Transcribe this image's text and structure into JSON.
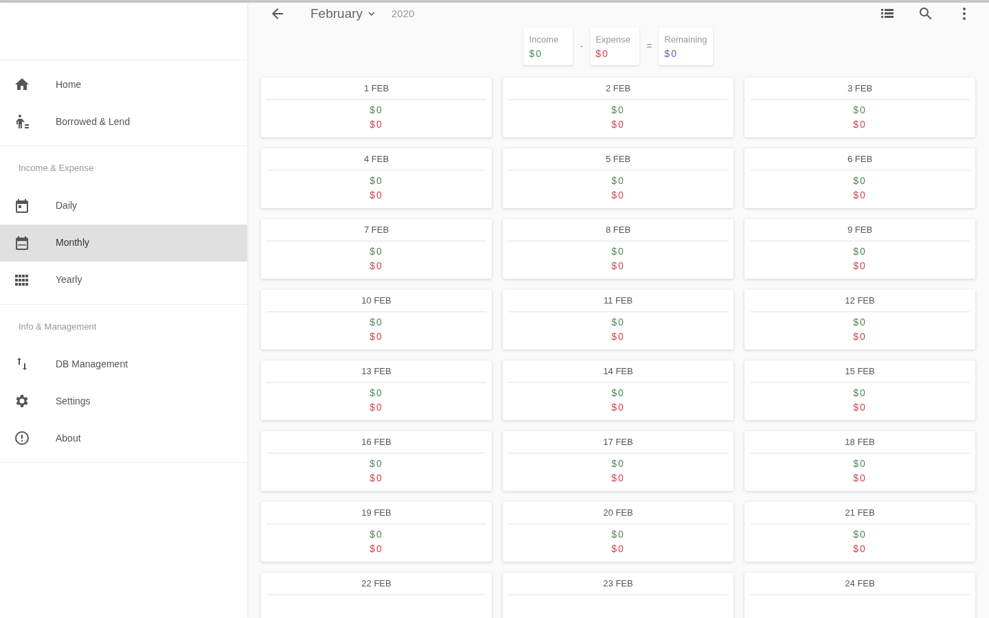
{
  "sidebar": {
    "groups": [
      {
        "items": [
          {
            "label": "Home",
            "kind": "home",
            "selected": false
          },
          {
            "label": "Borrowed & Lend",
            "kind": "person",
            "selected": false
          }
        ]
      },
      {
        "heading": "Income & Expense",
        "items": [
          {
            "label": "Daily",
            "kind": "daily",
            "selected": false
          },
          {
            "label": "Monthly",
            "kind": "monthly",
            "selected": true
          },
          {
            "label": "Yearly",
            "kind": "yearly",
            "selected": false
          }
        ]
      },
      {
        "heading": "Info & Management",
        "items": [
          {
            "label": "DB Management",
            "kind": "database",
            "selected": false
          },
          {
            "label": "Settings",
            "kind": "settings",
            "selected": false
          },
          {
            "label": "About",
            "kind": "about",
            "selected": false
          }
        ]
      }
    ]
  },
  "toolbar": {
    "month": "February",
    "year": "2020"
  },
  "summary": [
    {
      "label": "Income",
      "value": "$0",
      "kind": "income",
      "operator": "-"
    },
    {
      "label": "Expense",
      "value": "$0",
      "kind": "expense",
      "operator": "="
    },
    {
      "label": "Remaining",
      "value": "$0",
      "kind": "remaining"
    }
  ],
  "days": [
    {
      "date": "1 FEB",
      "income": "$0",
      "expense": "$0"
    },
    {
      "date": "2 FEB",
      "income": "$0",
      "expense": "$0"
    },
    {
      "date": "3 FEB",
      "income": "$0",
      "expense": "$0"
    },
    {
      "date": "4 FEB",
      "income": "$0",
      "expense": "$0"
    },
    {
      "date": "5 FEB",
      "income": "$0",
      "expense": "$0"
    },
    {
      "date": "6 FEB",
      "income": "$0",
      "expense": "$0"
    },
    {
      "date": "7 FEB",
      "income": "$0",
      "expense": "$0"
    },
    {
      "date": "8 FEB",
      "income": "$0",
      "expense": "$0"
    },
    {
      "date": "9 FEB",
      "income": "$0",
      "expense": "$0"
    },
    {
      "date": "10 FEB",
      "income": "$0",
      "expense": "$0"
    },
    {
      "date": "11 FEB",
      "income": "$0",
      "expense": "$0"
    },
    {
      "date": "12 FEB",
      "income": "$0",
      "expense": "$0"
    },
    {
      "date": "13 FEB",
      "income": "$0",
      "expense": "$0"
    },
    {
      "date": "14 FEB",
      "income": "$0",
      "expense": "$0"
    },
    {
      "date": "15 FEB",
      "income": "$0",
      "expense": "$0"
    },
    {
      "date": "16 FEB",
      "income": "$0",
      "expense": "$0"
    },
    {
      "date": "17 FEB",
      "income": "$0",
      "expense": "$0"
    },
    {
      "date": "18 FEB",
      "income": "$0",
      "expense": "$0"
    },
    {
      "date": "19 FEB",
      "income": "$0",
      "expense": "$0"
    },
    {
      "date": "20 FEB",
      "income": "$0",
      "expense": "$0"
    },
    {
      "date": "21 FEB",
      "income": "$0",
      "expense": "$0"
    },
    {
      "date": "22 FEB"
    },
    {
      "date": "23 FEB"
    },
    {
      "date": "24 FEB"
    }
  ]
}
